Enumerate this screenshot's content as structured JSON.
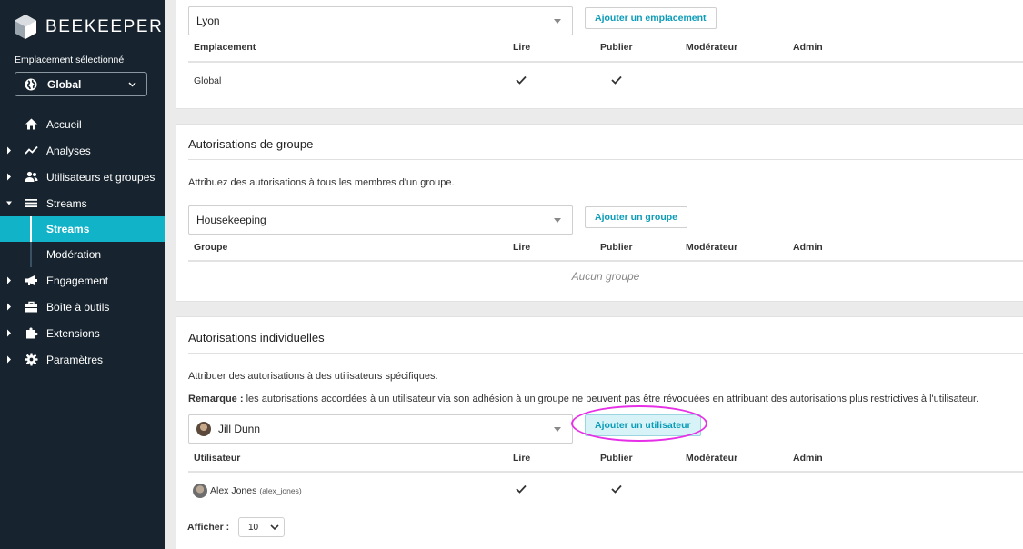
{
  "app": {
    "name": "BEEKEEPER"
  },
  "sidebar": {
    "location_label": "Emplacement sélectionné",
    "location_value": "Global",
    "items": [
      {
        "label": "Accueil",
        "icon": "home-icon"
      },
      {
        "label": "Analyses",
        "icon": "chart-line-icon"
      },
      {
        "label": "Utilisateurs et groupes",
        "icon": "users-icon"
      },
      {
        "label": "Streams",
        "icon": "list-icon"
      },
      {
        "label": "Engagement",
        "icon": "megaphone-icon"
      },
      {
        "label": "Boîte à outils",
        "icon": "toolbox-icon"
      },
      {
        "label": "Extensions",
        "icon": "puzzle-icon"
      },
      {
        "label": "Paramètres",
        "icon": "gear-icon"
      }
    ],
    "sub_items": [
      {
        "label": "Streams",
        "active": true
      },
      {
        "label": "Modération",
        "active": false
      }
    ]
  },
  "location_section": {
    "select_value": "Lyon",
    "add_button": "Ajouter un emplacement",
    "columns": [
      "Emplacement",
      "Lire",
      "Publier",
      "Modérateur",
      "Admin"
    ],
    "rows": [
      {
        "name": "Global",
        "read": true,
        "publish": true
      }
    ]
  },
  "group_section": {
    "title": "Autorisations de groupe",
    "description": "Attribuez des autorisations à tous les membres d'un groupe.",
    "select_value": "Housekeeping",
    "add_button": "Ajouter un groupe",
    "columns": [
      "Groupe",
      "Lire",
      "Publier",
      "Modérateur",
      "Admin"
    ],
    "empty": "Aucun groupe"
  },
  "individual_section": {
    "title": "Autorisations individuelles",
    "description": "Attribuer des autorisations à des utilisateurs spécifiques.",
    "note_label": "Remarque :",
    "note_text": " les autorisations accordées à un utilisateur via son adhésion à un groupe ne peuvent pas être révoquées en attribuant des autorisations plus restrictives à l'utilisateur.",
    "select_value": "Jill Dunn",
    "add_button": "Ajouter un utilisateur",
    "columns": [
      "Utilisateur",
      "Lire",
      "Publier",
      "Modérateur",
      "Admin"
    ],
    "rows": [
      {
        "name": "Alex Jones",
        "username": "(alex_jones)",
        "read": true,
        "publish": true
      }
    ]
  },
  "pagination": {
    "show_label": "Afficher :",
    "page_size": "10"
  },
  "colors": {
    "sidebar_bg": "#17242f",
    "accent": "#11b3c9",
    "highlight": "#e62fe6"
  }
}
